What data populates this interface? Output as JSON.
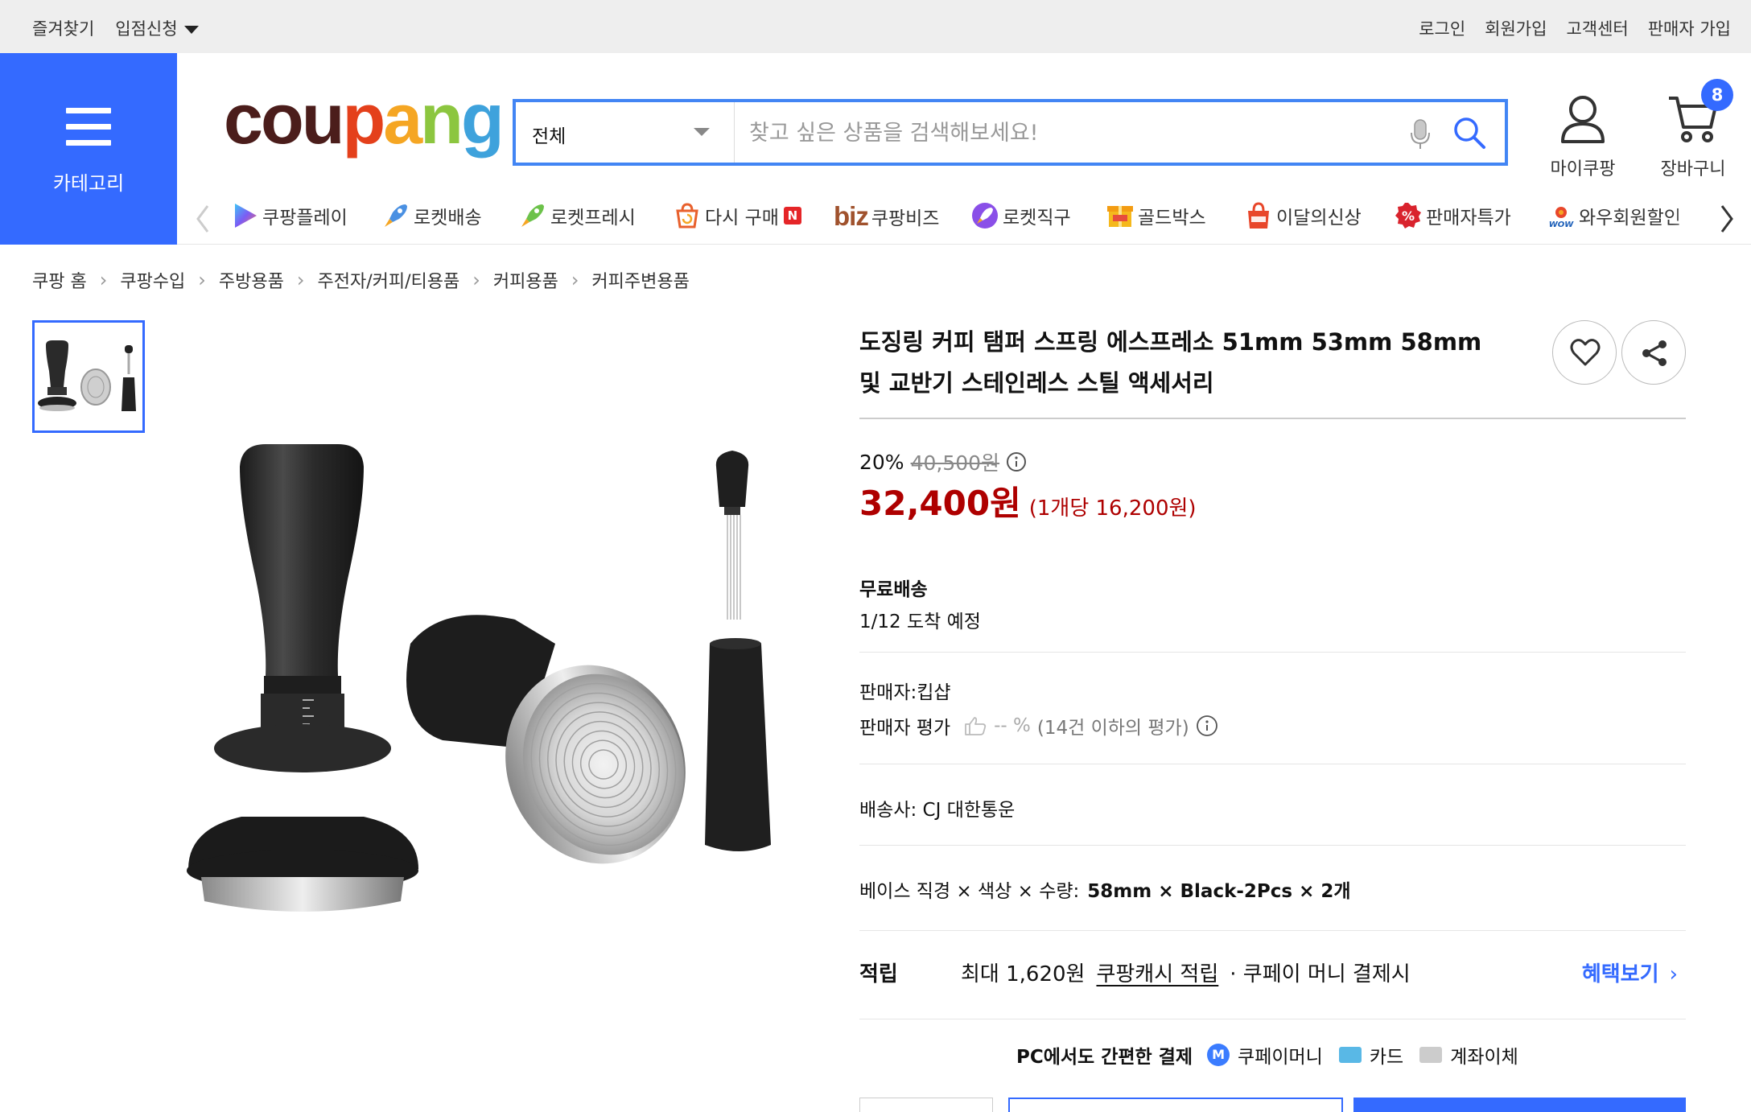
{
  "topbar": {
    "favorites": "즐겨찾기",
    "seller_apply": "입점신청",
    "login": "로그인",
    "signup": "회원가입",
    "customer_center": "고객센터",
    "seller_signup": "판매자 가입"
  },
  "header": {
    "category_label": "카테고리",
    "logo_text": [
      "cou",
      "p",
      "a",
      "n",
      "g"
    ],
    "search_category": "전체",
    "search_placeholder": "찾고 싶은 상품을 검색해보세요!",
    "mycoupang": "마이쿠팡",
    "cart": "장바구니",
    "cart_count": "8"
  },
  "quick_menu": [
    {
      "label": "쿠팡플레이",
      "icon": "play-icon"
    },
    {
      "label": "로켓배송",
      "icon": "rocket-icon"
    },
    {
      "label": "로켓프레시",
      "icon": "rocket-fresh-icon"
    },
    {
      "label": "다시 구매",
      "icon": "rebuy-icon",
      "badge": "N"
    },
    {
      "label": "쿠팡비즈",
      "icon": "biz-icon",
      "prefix": "biz"
    },
    {
      "label": "로켓직구",
      "icon": "rocket-global-icon"
    },
    {
      "label": "골드박스",
      "icon": "goldbox-icon"
    },
    {
      "label": "이달의신상",
      "icon": "new-bag-icon"
    },
    {
      "label": "판매자특가",
      "icon": "percent-icon"
    },
    {
      "label": "와우회원할인",
      "icon": "wow-icon"
    }
  ],
  "breadcrumb": [
    "쿠팡 홈",
    "쿠팡수입",
    "주방용품",
    "주전자/커피/티용품",
    "커피용품",
    "커피주변용품"
  ],
  "product": {
    "title": "도징링 커피 탬퍼 스프링 에스프레소 51mm 53mm 58mm 및 교반기 스테인레스 스틸 액세서리",
    "discount_rate": "20%",
    "original_price": "40,500원",
    "price": "32,400원",
    "unit_price": "(1개당 16,200원)",
    "shipping_label": "무료배송",
    "arrival": "1/12 도착 예정",
    "seller": "판매자:킵샵",
    "seller_rating_label": "판매자 평가",
    "seller_rating_value": "-- %",
    "seller_rating_note": "(14건 이하의 평가)",
    "courier": "배송사:  CJ 대한통운",
    "option_label": "베이스 직경 × 색상 × 수량:",
    "option_value": "58mm × Black-2Pcs × 2개",
    "reward_label": "적립",
    "reward_max": "최대 1,620원",
    "reward_link": "쿠팡캐시 적립",
    "reward_note": "· 쿠페이 머니 결제시",
    "benefit_link": "혜택보기",
    "pay_header": "PC에서도 간편한 결제",
    "pay_money": "쿠페이머니",
    "pay_money_icon": "M",
    "pay_card": "카드",
    "pay_bank": "계좌이체"
  },
  "colors": {
    "accent": "#346aff",
    "price_red": "#ae0000",
    "topbar_bg": "#eeeeee"
  }
}
